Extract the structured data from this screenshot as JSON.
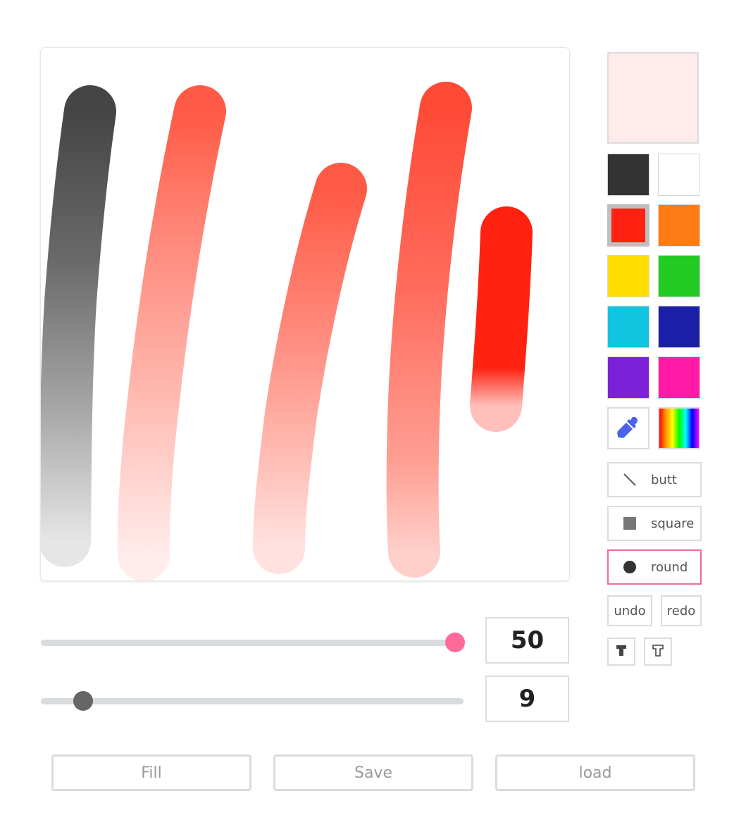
{
  "colors": {
    "preview": "#ffebeb",
    "accent": "#ee6a9c",
    "swatches": [
      "#333333",
      "#ffffff",
      "#ff2211",
      "#ff7c15",
      "#ffdd00",
      "#22cc22",
      "#11c4df",
      "#1b20a8",
      "#7b22d9",
      "#ff1aa8"
    ]
  },
  "selected_color": "#ff2211",
  "icons": {
    "eyedropper": "eyedropper-icon",
    "rainbow": "rainbow-gradient-icon",
    "butt": "line-icon",
    "square": "square-icon",
    "round": "circle-icon",
    "font_bold": "font-bold-icon",
    "font_outline": "font-outline-icon"
  },
  "line_caps": {
    "butt": "butt",
    "square": "square",
    "round": "round",
    "active": "round"
  },
  "history": {
    "undo": "undo",
    "redo": "redo"
  },
  "sliders": {
    "size": {
      "value": "50",
      "fraction": 0.98,
      "thumb_color": "#ff6a9a"
    },
    "opacity": {
      "value": "9",
      "fraction": 0.1,
      "thumb_color": "#666666"
    }
  },
  "buttons": {
    "fill": "Fill",
    "save": "Save",
    "load": "load"
  }
}
